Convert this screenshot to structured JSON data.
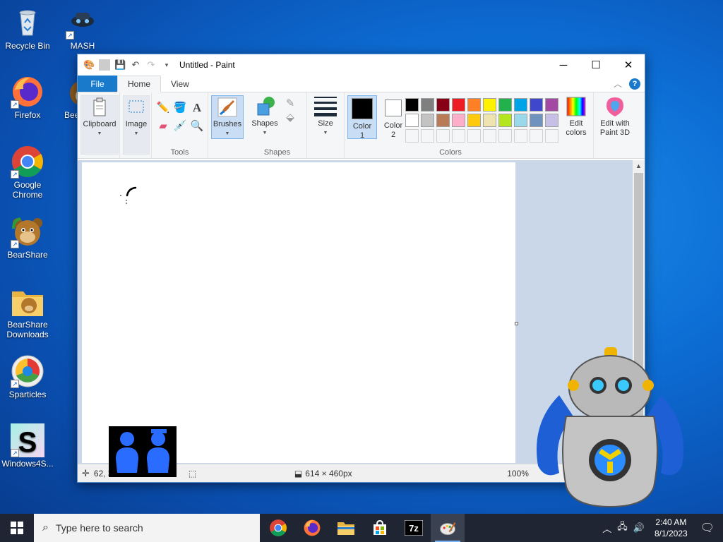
{
  "desktop": {
    "icons": [
      {
        "label": "Recycle Bin",
        "icon": "recycle-bin-icon"
      },
      {
        "label": "MASH",
        "icon": "mash-icon"
      },
      {
        "label": "Firefox",
        "icon": "firefox-icon"
      },
      {
        "label": "Bee",
        "icon": "bearshare-icon"
      },
      {
        "label": "Google Chrome",
        "icon": "chrome-icon"
      },
      {
        "label": "BearShare",
        "icon": "bearshare-icon"
      },
      {
        "label": "BearShare Downloads",
        "icon": "folder-icon"
      },
      {
        "label": "Sparticles",
        "icon": "sparticles-icon"
      },
      {
        "label": "Windows4S...",
        "icon": "s-app-icon"
      }
    ]
  },
  "window": {
    "title": "Untitled - Paint",
    "tabs": [
      "File",
      "Home",
      "View"
    ],
    "active_tab": "Home"
  },
  "ribbon": {
    "clipboard": "Clipboard",
    "image": "Image",
    "tools": "Tools",
    "brushes": "Brushes",
    "shapes_btn": "Shapes",
    "shapes_group": "Shapes",
    "size": "Size",
    "color1": "Color\n1",
    "color1_a": "Color",
    "color1_b": "1",
    "color2_a": "Color",
    "color2_b": "2",
    "colors_group": "Colors",
    "edit_colors_a": "Edit",
    "edit_colors_b": "colors",
    "paint3d_a": "Edit with",
    "paint3d_b": "Paint 3D",
    "palette_row1": [
      "#000000",
      "#7f7f7f",
      "#880015",
      "#ed1c24",
      "#ff7f27",
      "#fff200",
      "#22b14c",
      "#00a2e8",
      "#3f48cc",
      "#a349a4"
    ],
    "palette_row2": [
      "#ffffff",
      "#c3c3c3",
      "#b97a57",
      "#ffaec9",
      "#ffc90e",
      "#efe4b0",
      "#b5e61d",
      "#99d9ea",
      "#7092be",
      "#c8bfe7"
    ],
    "color1_value": "#000000",
    "color2_value": "#ffffff"
  },
  "status": {
    "cursor_pos": "62, 3",
    "canvas_size": "614 × 460px",
    "zoom": "100%"
  },
  "taskbar": {
    "search_placeholder": "Type here to search",
    "time": "2:40 AM",
    "date": "8/1/2023"
  }
}
